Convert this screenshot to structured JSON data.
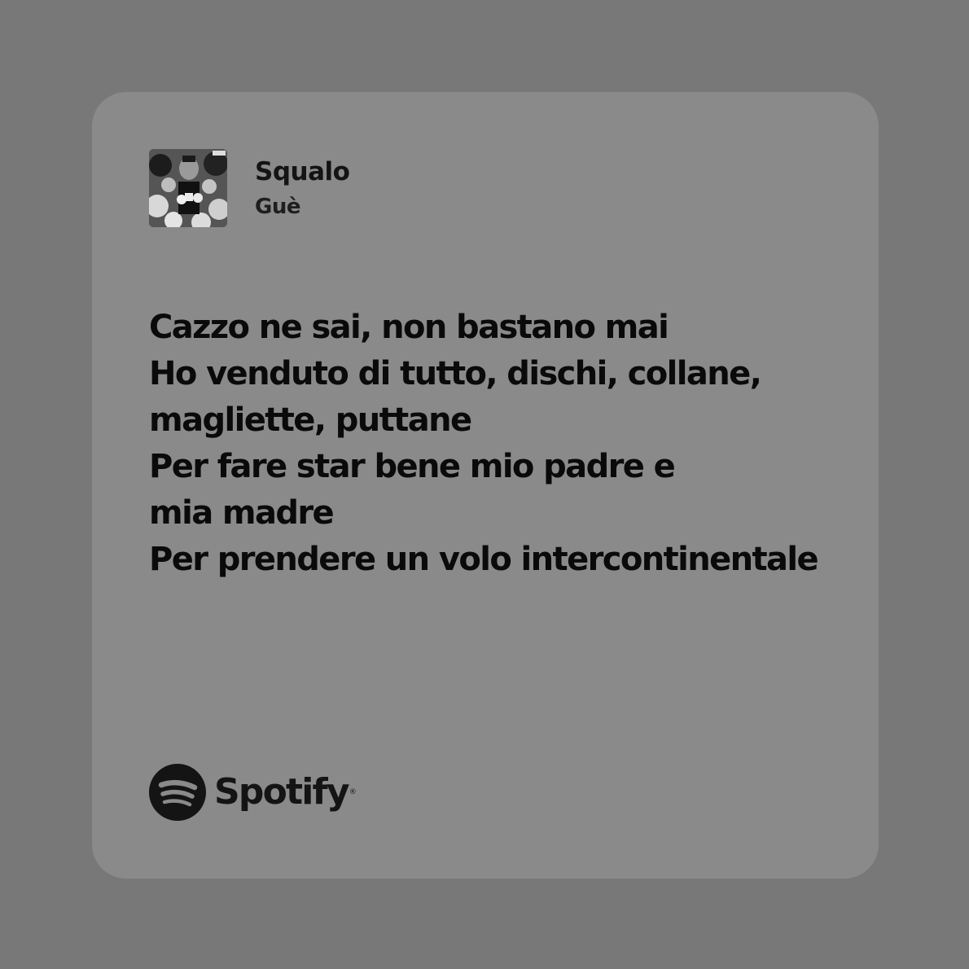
{
  "track": {
    "title": "Squalo",
    "artist": "Guè",
    "cover_icon": "album-cover-image"
  },
  "lyrics": [
    "Cazzo ne sai, non bastano mai",
    "Ho venduto di tutto, dischi, collane,",
    "magliette, puttane",
    "Per fare star bene mio padre e",
    "mia madre",
    "Per prendere un volo intercontinentale"
  ],
  "brand": {
    "name": "Spotify",
    "icon": "spotify-logo-icon"
  },
  "colors": {
    "background": "#787878",
    "card": "#8a8a8a",
    "text": "#0a0a0a"
  }
}
